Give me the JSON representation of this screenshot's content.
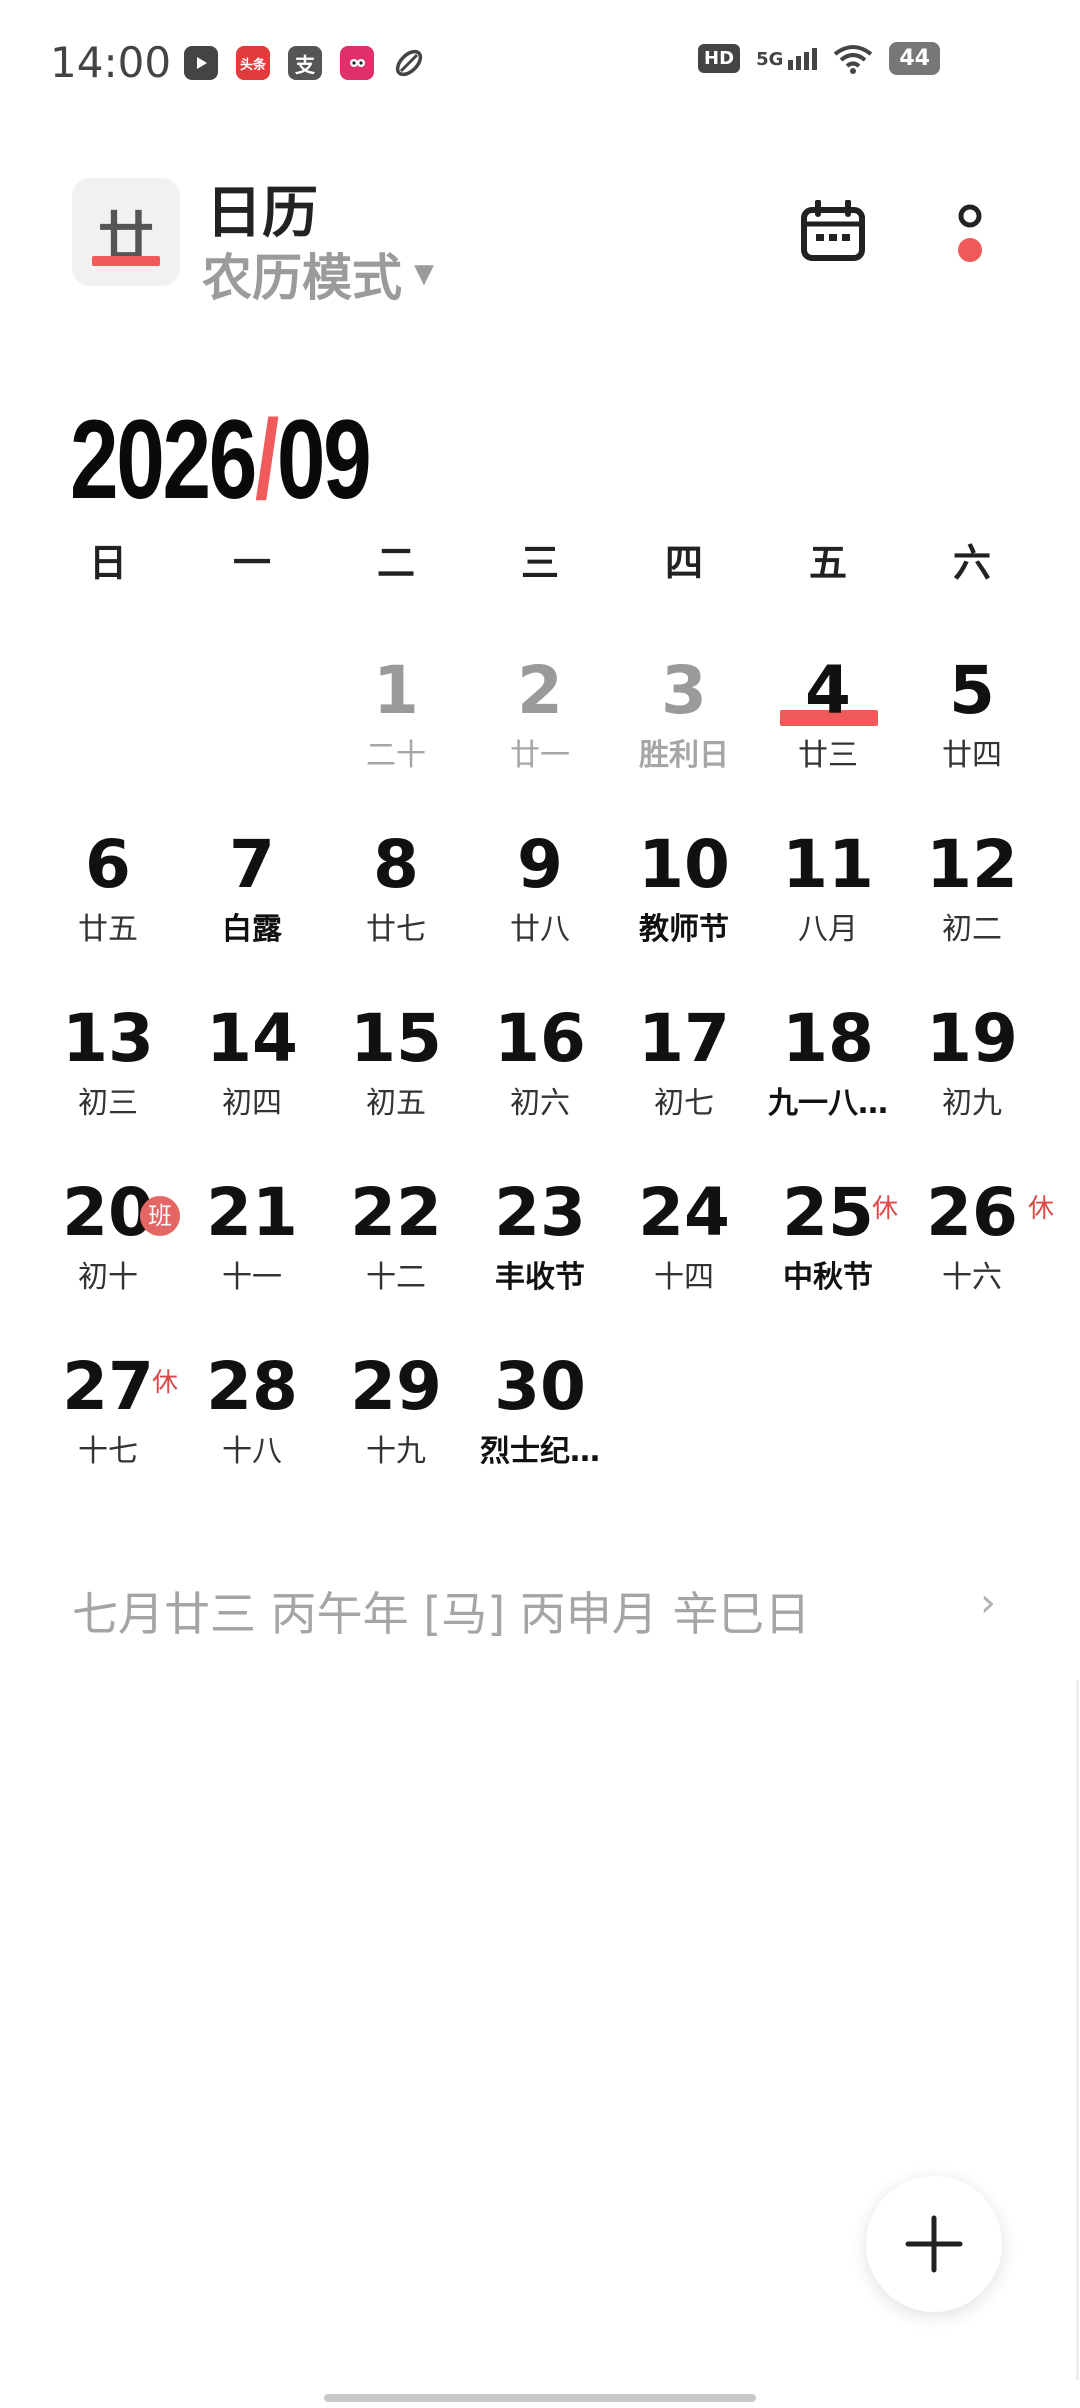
{
  "status_bar": {
    "time": "14:00",
    "hd": "HD",
    "network": "5G",
    "battery": "44",
    "app_icons": [
      "video-icon",
      "toutiao-icon",
      "alipay-icon",
      "douyin-icon",
      "app-icon"
    ],
    "toutiao_label": "头条",
    "alipay_label": "支"
  },
  "header": {
    "logo_char": "廿",
    "title": "日历",
    "mode": "农历模式",
    "mode_arrow": "▼",
    "accent": "#f05a5a"
  },
  "month": {
    "year": "2026",
    "slash": "/",
    "month": "09"
  },
  "weekdays": [
    "日",
    "一",
    "二",
    "三",
    "四",
    "五",
    "六"
  ],
  "days": [
    {
      "n": "",
      "s": ""
    },
    {
      "n": "",
      "s": ""
    },
    {
      "n": "1",
      "s": "二十"
    },
    {
      "n": "2",
      "s": "廿一"
    },
    {
      "n": "3",
      "s": "胜利日"
    },
    {
      "n": "4",
      "s": "廿三"
    },
    {
      "n": "5",
      "s": "廿四"
    },
    {
      "n": "6",
      "s": "廿五"
    },
    {
      "n": "7",
      "s": "白露"
    },
    {
      "n": "8",
      "s": "廿七"
    },
    {
      "n": "9",
      "s": "廿八"
    },
    {
      "n": "10",
      "s": "教师节"
    },
    {
      "n": "11",
      "s": "八月"
    },
    {
      "n": "12",
      "s": "初二"
    },
    {
      "n": "13",
      "s": "初三"
    },
    {
      "n": "14",
      "s": "初四"
    },
    {
      "n": "15",
      "s": "初五"
    },
    {
      "n": "16",
      "s": "初六"
    },
    {
      "n": "17",
      "s": "初七"
    },
    {
      "n": "18",
      "s": "九一八…"
    },
    {
      "n": "19",
      "s": "初九"
    },
    {
      "n": "20",
      "s": "初十",
      "badge": "班"
    },
    {
      "n": "21",
      "s": "十一"
    },
    {
      "n": "22",
      "s": "十二"
    },
    {
      "n": "23",
      "s": "丰收节"
    },
    {
      "n": "24",
      "s": "十四"
    },
    {
      "n": "25",
      "s": "中秋节",
      "badge": "休"
    },
    {
      "n": "26",
      "s": "十六",
      "badge": "休"
    },
    {
      "n": "27",
      "s": "十七",
      "badge": "休"
    },
    {
      "n": "28",
      "s": "十八"
    },
    {
      "n": "29",
      "s": "十九"
    },
    {
      "n": "30",
      "s": "烈士纪…"
    }
  ],
  "lunar_info": "七月廿三  丙午年 [马] 丙申月 辛巳日",
  "chevron": "›",
  "fab_label": "+"
}
